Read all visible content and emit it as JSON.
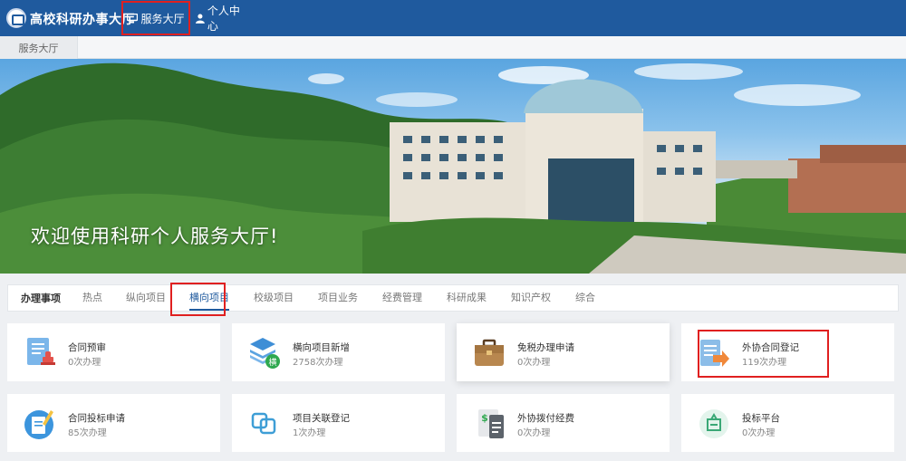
{
  "header": {
    "brand": "高校科研办事大厅",
    "nav": [
      {
        "label": "服务大厅",
        "icon": "monitor-icon"
      },
      {
        "label": "个人中心",
        "icon": "user-icon"
      }
    ]
  },
  "breadcrumb": "服务大厅",
  "banner": {
    "title": "欢迎使用科研个人服务大厅!"
  },
  "tabs": {
    "heading": "办理事项",
    "items": [
      "热点",
      "纵向项目",
      "横向项目",
      "校级项目",
      "项目业务",
      "经费管理",
      "科研成果",
      "知识产权",
      "综合"
    ],
    "active": "横向项目"
  },
  "cards": [
    {
      "title": "合同预审",
      "count": "0次办理",
      "icon": "contract-stamp-icon"
    },
    {
      "title": "横向项目新增",
      "count": "2758次办理",
      "icon": "layers-badge-icon"
    },
    {
      "title": "免税办理申请",
      "count": "0次办理",
      "icon": "briefcase-icon"
    },
    {
      "title": "外协合同登记",
      "count": "119次办理",
      "icon": "document-arrow-icon"
    },
    {
      "title": "合同投标申请",
      "count": "85次办理",
      "icon": "pen-document-icon"
    },
    {
      "title": "项目关联登记",
      "count": "1次办理",
      "icon": "link-squares-icon"
    },
    {
      "title": "外协拨付经费",
      "count": "0次办理",
      "icon": "payment-document-icon"
    },
    {
      "title": "投标平台",
      "count": "0次办理",
      "icon": "bid-platform-icon"
    }
  ],
  "colors": {
    "primary": "#1f5a9e",
    "highlight": "#e02020"
  }
}
